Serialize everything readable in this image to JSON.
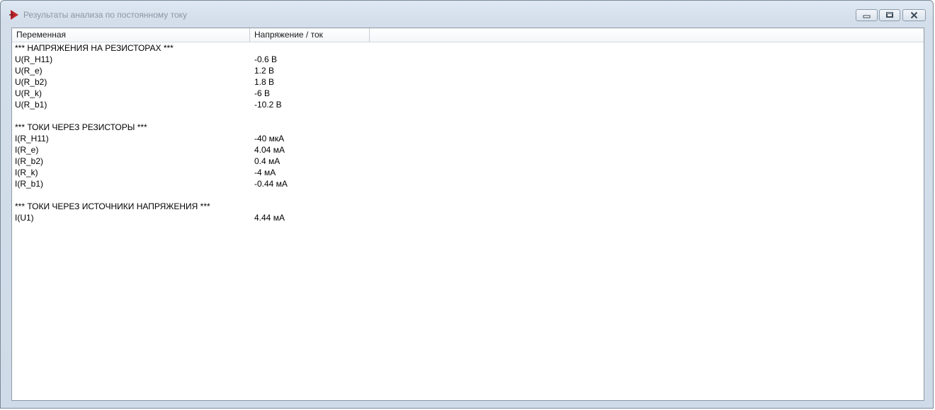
{
  "window": {
    "title": "Результаты анализа по постоянному току"
  },
  "table": {
    "columns": [
      "Переменная",
      "Напряжение / ток",
      ""
    ],
    "rows": [
      {
        "name": "*** НАПРЯЖЕНИЯ НА РЕЗИСТОРАХ ***",
        "value": ""
      },
      {
        "name": "U(R_H11)",
        "value": "-0.6 В"
      },
      {
        "name": "U(R_e)",
        "value": "1.2 В"
      },
      {
        "name": "U(R_b2)",
        "value": "1.8 В"
      },
      {
        "name": "U(R_k)",
        "value": "-6 В"
      },
      {
        "name": "U(R_b1)",
        "value": "-10.2 В"
      },
      {
        "name": "",
        "value": ""
      },
      {
        "name": "*** ТОКИ ЧЕРЕЗ РЕЗИСТОРЫ ***",
        "value": ""
      },
      {
        "name": "I(R_H11)",
        "value": "-40 мкА"
      },
      {
        "name": "I(R_e)",
        "value": "4.04 мА"
      },
      {
        "name": "I(R_b2)",
        "value": "0.4 мА"
      },
      {
        "name": "I(R_k)",
        "value": "-4 мА"
      },
      {
        "name": "I(R_b1)",
        "value": "-0.44 мА"
      },
      {
        "name": "",
        "value": ""
      },
      {
        "name": "*** ТОКИ ЧЕРЕЗ ИСТОЧНИКИ НАПРЯЖЕНИЯ ***",
        "value": ""
      },
      {
        "name": "I(U1)",
        "value": "4.44 мА"
      }
    ]
  },
  "icons": {
    "app": "app-icon",
    "minimize": "minimize-icon",
    "maximize": "maximize-icon",
    "close": "close-icon"
  },
  "colors": {
    "title_text": "#8a96a2",
    "frame": "#d3deea",
    "app_icon": "#c0262d"
  }
}
